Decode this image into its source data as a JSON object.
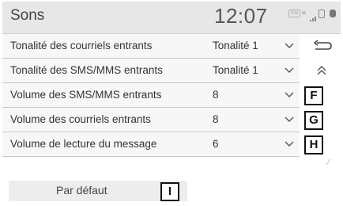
{
  "header": {
    "title": "Sons",
    "clock": "12:07",
    "status_icons": [
      "roaming-badge-icon",
      "no-signal-icon",
      "signal-bars-icon",
      "lock-icon",
      "phone-battery-icon"
    ]
  },
  "settings": [
    {
      "label": "Tonalité des courriels entrants",
      "value": "Tonalité 1",
      "callout": ""
    },
    {
      "label": "Tonalité des SMS/MMS entrants",
      "value": "Tonalité 1",
      "callout": ""
    },
    {
      "label": "Volume des SMS/MMS entrants",
      "value": "8",
      "callout": "F"
    },
    {
      "label": "Volume des courriels entrants",
      "value": "8",
      "callout": "G"
    },
    {
      "label": "Volume de lecture du message",
      "value": "6",
      "callout": "H"
    }
  ],
  "default_button": {
    "label": "Par défaut",
    "callout": "I"
  },
  "side": {
    "back_icon": "back-arrow-icon",
    "scroll_up_icon": "double-chevron-up-icon"
  },
  "colors": {
    "header_bg": "#e7e7e7",
    "row_bg": "#f7f7f7",
    "button_bg": "#ededed"
  }
}
